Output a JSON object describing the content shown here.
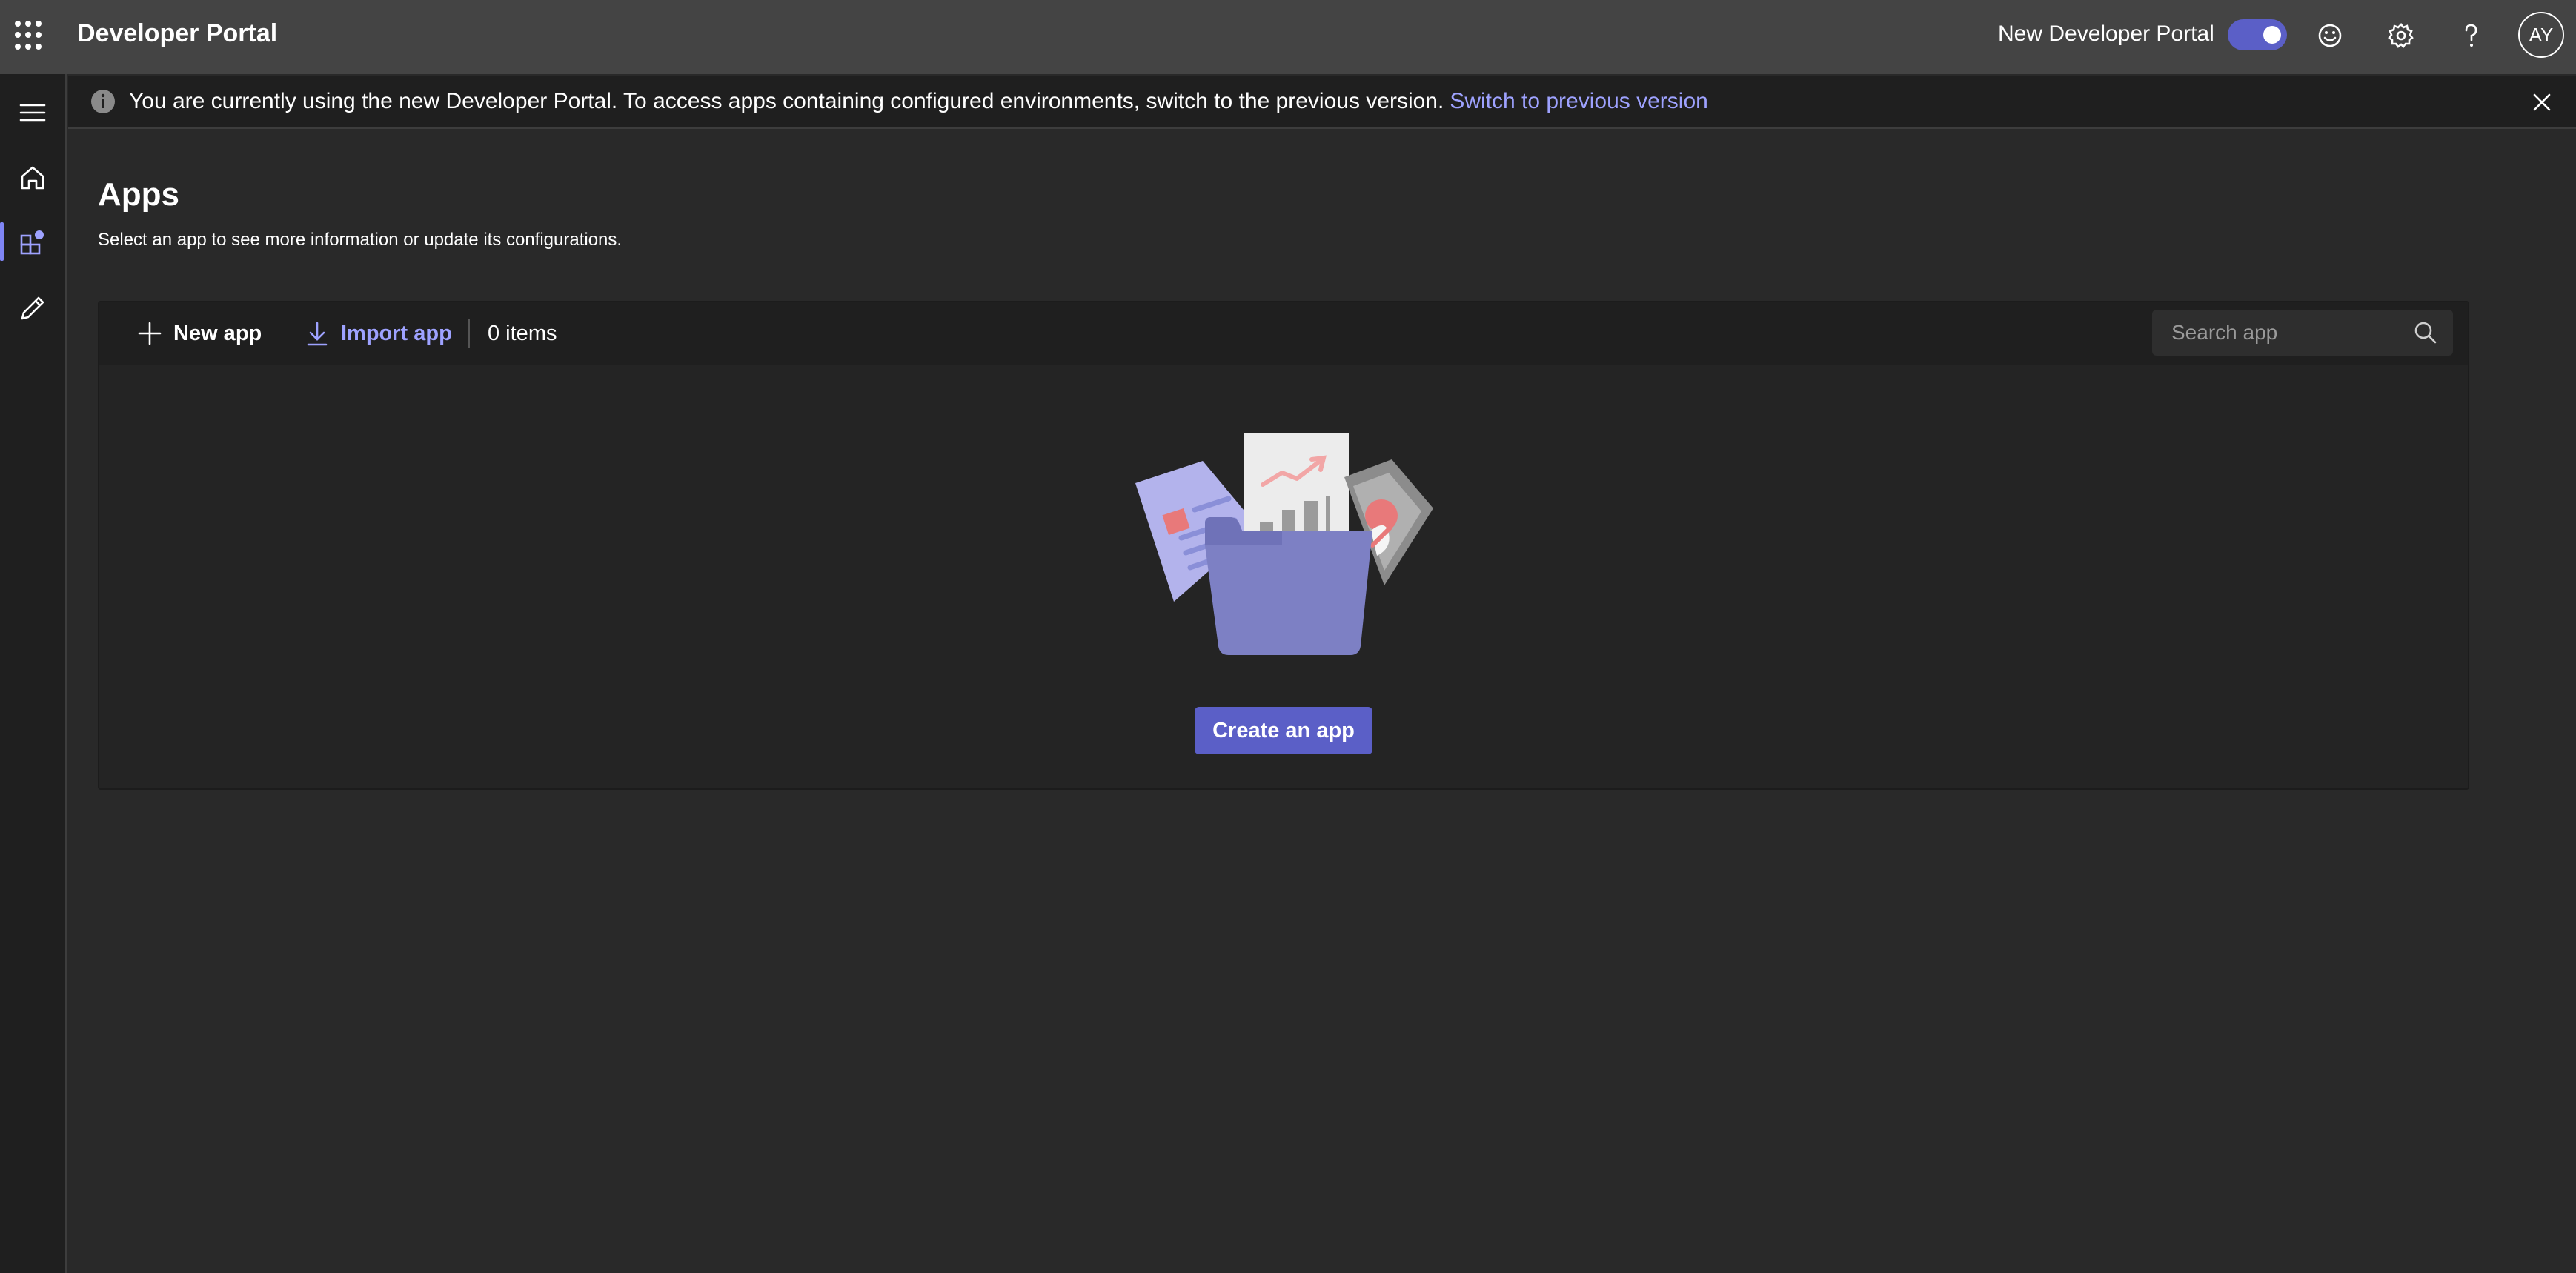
{
  "header": {
    "app_title": "Developer Portal",
    "toggle_label": "New Developer Portal",
    "toggle_on": true,
    "avatar_initials": "AY",
    "icons": [
      "app-launcher-icon",
      "feedback-smiley-icon",
      "settings-gear-icon",
      "help-question-icon"
    ]
  },
  "rail": {
    "items": [
      {
        "name": "menu",
        "icon": "hamburger-icon"
      },
      {
        "name": "home",
        "icon": "home-icon"
      },
      {
        "name": "apps",
        "icon": "apps-icon",
        "active": true
      },
      {
        "name": "tools",
        "icon": "pencil-icon"
      }
    ]
  },
  "banner": {
    "message": "You are currently using the new Developer Portal. To access apps containing configured environments, switch to the previous version.",
    "link_text": "Switch to previous version"
  },
  "page": {
    "title": "Apps",
    "subtitle": "Select an app to see more information or update its configurations."
  },
  "toolbar": {
    "new_app_label": "New app",
    "import_app_label": "Import app",
    "item_count": "0 items",
    "search_placeholder": "Search app"
  },
  "empty_state": {
    "create_button_label": "Create an app"
  },
  "colors": {
    "accent": "#5b5fc7",
    "link": "#9ea2ff",
    "header_bg": "#444444",
    "page_bg": "#292929"
  }
}
